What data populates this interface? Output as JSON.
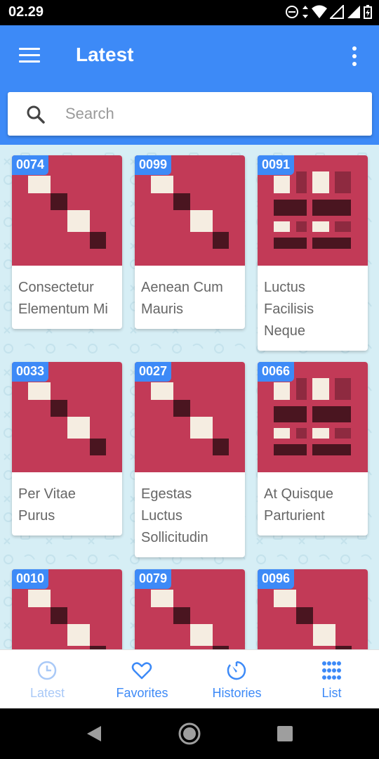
{
  "status": {
    "time": "02.29"
  },
  "appbar": {
    "title": "Latest"
  },
  "search": {
    "placeholder": "Search"
  },
  "items": [
    {
      "id": "0074",
      "title": "Consectetur Elementum Mi"
    },
    {
      "id": "0099",
      "title": "Aenean Cum Mauris"
    },
    {
      "id": "0091",
      "title": "Luctus Facilisis Neque"
    },
    {
      "id": "0033",
      "title": "Per Vitae Purus"
    },
    {
      "id": "0027",
      "title": "Egestas Luctus Sollicitudin"
    },
    {
      "id": "0066",
      "title": "At Quisque Parturient"
    },
    {
      "id": "0010",
      "title": ""
    },
    {
      "id": "0079",
      "title": ""
    },
    {
      "id": "0096",
      "title": ""
    }
  ],
  "nav": {
    "latest": "Latest",
    "favorites": "Favorites",
    "histories": "Histories",
    "list": "List"
  },
  "colors": {
    "primary": "#3d8af7",
    "tile": "#c23a57",
    "dark": "#4a1520",
    "cream": "#f5ede1"
  }
}
